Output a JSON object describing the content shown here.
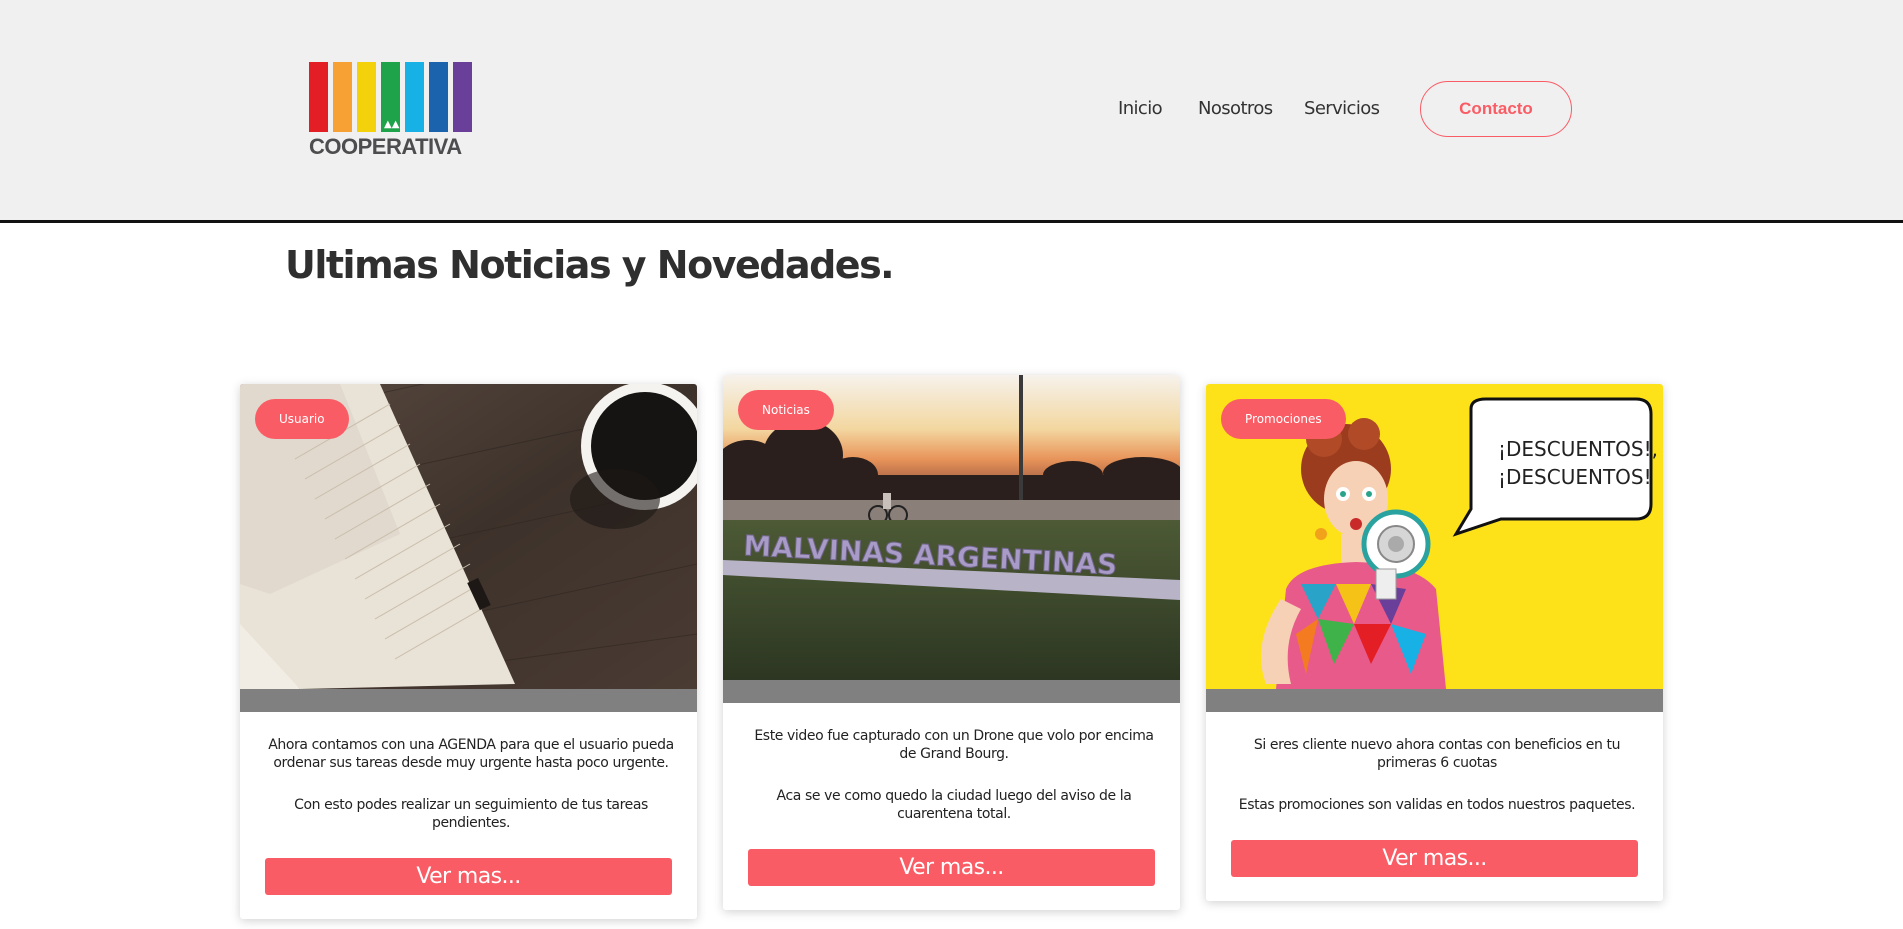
{
  "logo": {
    "text": "COOPERATIVA",
    "bar_colors": [
      "#e31e24",
      "#f7a033",
      "#f4d20b",
      "#1ea24a",
      "#17b1e5",
      "#1c63ad",
      "#6a3f99"
    ]
  },
  "nav": {
    "items": [
      {
        "label": "Inicio"
      },
      {
        "label": "Nosotros"
      },
      {
        "label": "Servicios"
      }
    ],
    "contact_label": "Contacto"
  },
  "section": {
    "title": "Ultimas Noticias y Novedades."
  },
  "cards": [
    {
      "badge": "Usuario",
      "image": "notebook-and-coffee",
      "paragraphs": [
        "Ahora contamos con una AGENDA para que el usuario pueda ordenar sus tareas desde muy urgente hasta poco urgente.",
        "Con esto podes realizar un seguimiento de tus tareas pendientes."
      ],
      "button": "Ver mas..."
    },
    {
      "badge": "Noticias",
      "image": "malvinas-argentinas-sign",
      "sign_text": "MALVINAS ARGENTINAS",
      "paragraphs": [
        "Este video fue capturado con un Drone que volo por encima de Grand Bourg.",
        "Aca se ve como quedo la ciudad luego del aviso de la cuarentena total."
      ],
      "button": "Ver mas..."
    },
    {
      "badge": "Promociones",
      "image": "woman-with-megaphone",
      "bubble_text": "¡DESCUENTOS!, ¡DESCUENTOS!",
      "paragraphs": [
        "Si eres cliente nuevo ahora contas con beneficios en tu primeras 6 cuotas",
        "Estas promociones son validas en todos nuestros paquetes."
      ],
      "button": "Ver mas..."
    }
  ],
  "colors": {
    "accent": "#fa5c65",
    "header_bg": "#f0f0f0",
    "strip": "#808080"
  }
}
